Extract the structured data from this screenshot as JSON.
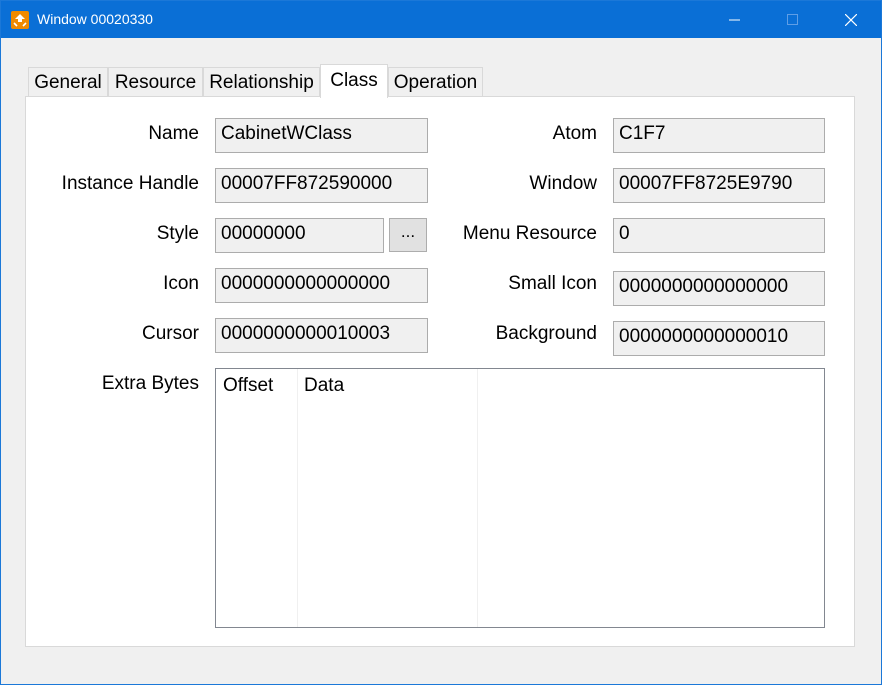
{
  "window": {
    "title": "Window 00020330"
  },
  "titlebar_icons": {
    "app": "app-icon",
    "minimize": "minimize-icon",
    "maximize": "maximize-icon",
    "close": "close-icon"
  },
  "tabs": [
    {
      "label": "General",
      "selected": false
    },
    {
      "label": "Resource",
      "selected": false
    },
    {
      "label": "Relationship",
      "selected": false
    },
    {
      "label": "Class",
      "selected": true
    },
    {
      "label": "Operation",
      "selected": false
    }
  ],
  "class_tab": {
    "name": {
      "label": "Name",
      "value": "CabinetWClass"
    },
    "instance_handle": {
      "label": "Instance Handle",
      "value": "00007FF872590000"
    },
    "style": {
      "label": "Style",
      "value": "00000000",
      "button_label": "..."
    },
    "icon": {
      "label": "Icon",
      "value": "0000000000000000"
    },
    "cursor": {
      "label": "Cursor",
      "value": "0000000000010003"
    },
    "atom": {
      "label": "Atom",
      "value": "C1F7"
    },
    "window": {
      "label": "Window",
      "value": "00007FF8725E9790"
    },
    "menu_resource": {
      "label": "Menu Resource",
      "value": "0"
    },
    "small_icon": {
      "label": "Small Icon",
      "value": "0000000000000000"
    },
    "background": {
      "label": "Background",
      "value": "0000000000000010"
    },
    "extra_bytes": {
      "label": "Extra Bytes",
      "columns": [
        "Offset",
        "Data"
      ],
      "rows": []
    }
  },
  "colors": {
    "titlebar": "#0a6fd6",
    "app_icon": "#f08a00",
    "field_bg": "#f0f0f0",
    "window_bg": "#f0f0f0"
  }
}
